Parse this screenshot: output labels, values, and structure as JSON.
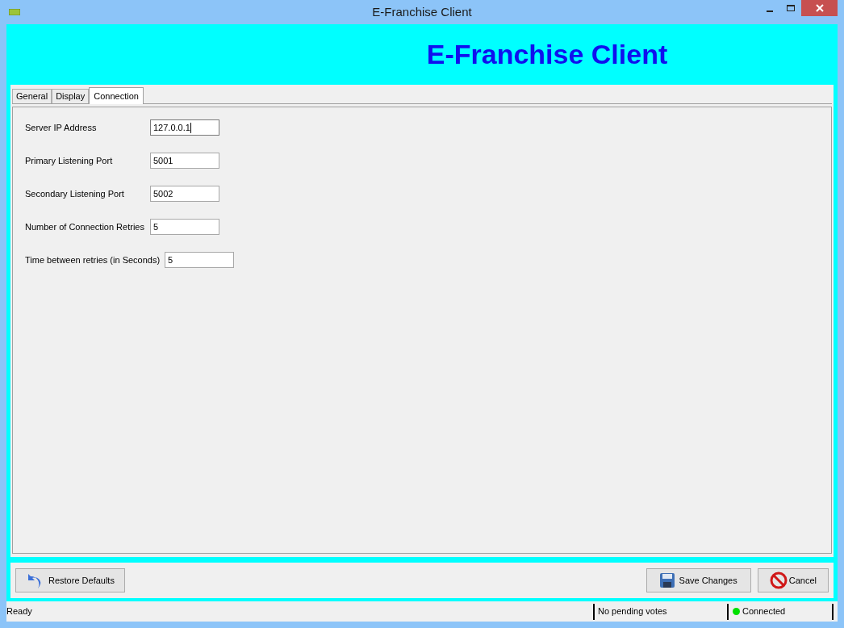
{
  "window": {
    "title": "E-Franchise Client"
  },
  "header": {
    "title": "E-Franchise Client"
  },
  "tabs": [
    {
      "label": "General",
      "selected": false
    },
    {
      "label": "Display",
      "selected": false
    },
    {
      "label": "Connection",
      "selected": true
    }
  ],
  "fields": [
    {
      "label": "Server IP Address",
      "value": "127.0.0.1",
      "focused": true
    },
    {
      "label": "Primary Listening Port",
      "value": "5001",
      "focused": false
    },
    {
      "label": "Secondary Listening Port",
      "value": "5002",
      "focused": false
    },
    {
      "label": "Number of Connection Retries",
      "value": "5",
      "focused": false
    },
    {
      "label": "Time between retries (in Seconds)",
      "value": "5",
      "focused": false
    }
  ],
  "buttons": {
    "restore": "Restore Defaults",
    "save": "Save Changes",
    "cancel": "Cancel"
  },
  "status_bar": {
    "message": "Ready",
    "votes": "No pending votes",
    "connection": "Connected",
    "connected": true
  }
}
